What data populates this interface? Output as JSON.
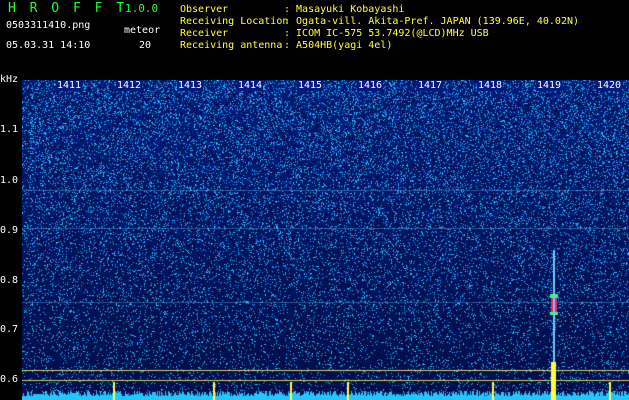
{
  "header": {
    "brand": "H R O F F T",
    "version": "1.0.0",
    "filename": "0503311410.png",
    "datetime": "05.03.31 14:10",
    "meteor_label": "meteor",
    "meteor_count": "20"
  },
  "info": [
    {
      "label": "Observer",
      "value": ": Masayuki Kobayashi"
    },
    {
      "label": "Receiving Location",
      "value": ": Ogata-vill. Akita-Pref. JAPAN (139.96E, 40.02N)"
    },
    {
      "label": "Receiver",
      "value": ": ICOM IC-575 53.7492(@LCD)MHz USB"
    },
    {
      "label": "Receiving antenna",
      "value": ": A504HB(yagi 4el)"
    }
  ],
  "axis": {
    "y_unit": "kHz",
    "y_ticks": [
      "1.1",
      "1.0",
      "0.9",
      "0.8",
      "0.7",
      "0.6"
    ],
    "x_ticks": [
      "1411",
      "1412",
      "1413",
      "1414",
      "1415",
      "1416",
      "1417",
      "1418",
      "1419",
      "1420"
    ]
  },
  "colors": {
    "background": "#000000",
    "spectrogram_low": "#00115a",
    "spectrogram_high": "#2266ff",
    "echo": "#ff2060",
    "label_green": "#22ff22",
    "label_yellow": "#ffff40",
    "level_bar": "#20c8ff"
  }
}
